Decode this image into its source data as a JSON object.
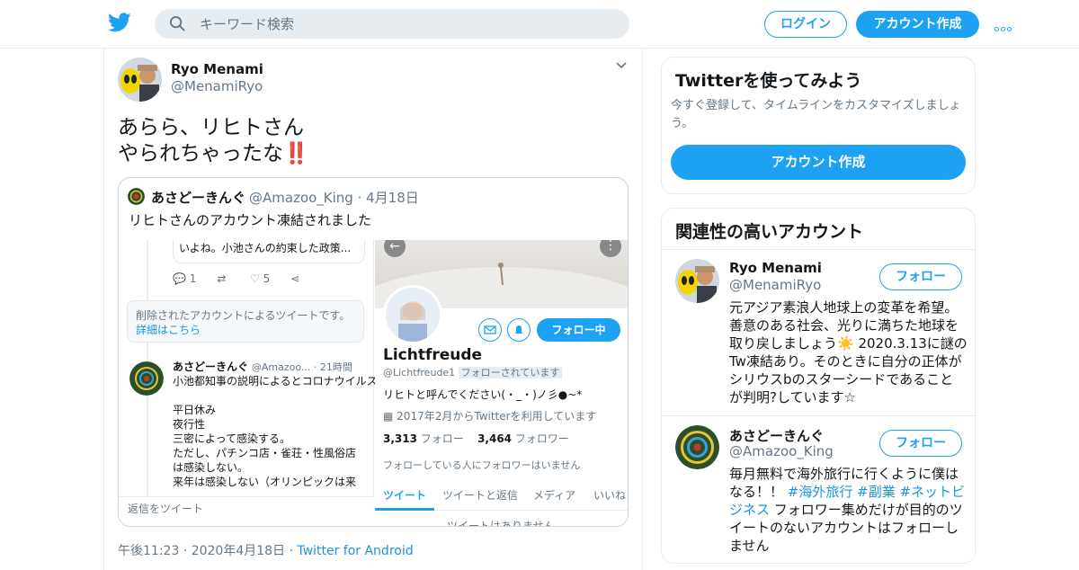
{
  "header": {
    "search_placeholder": "キーワード検索",
    "login_label": "ログイン",
    "signup_label": "アカウント作成"
  },
  "tweet": {
    "author_name": "Ryo Menami",
    "author_handle": "@MenamiRyo",
    "text_line1": "あらら、リヒトさん",
    "text_line2": "やられちゃったな",
    "text_emoji": "‼️",
    "timestamp": "午後11:23 · 2020年4月18日 · ",
    "source": "Twitter for Android"
  },
  "quote": {
    "author_name": "あさどーきんぐ",
    "author_handle": "@Amazoo_King",
    "date": "4月18日",
    "text": "リヒトさんのアカウント凍結されました",
    "screenshot": {
      "left": {
        "snippet": "いよね。小池さんの約束した政策...",
        "reply_count": "1",
        "like_count": "5",
        "deleted_notice": "削除されたアカウントによるツイートです。",
        "details_link": "詳細はこちら",
        "reply_author": "あさどーきんぐ",
        "reply_handle": "@Amazoo... · 21時間",
        "reply_lines": [
          "小池都知事の説明によるとコロナウイルスは",
          "",
          "平日休み",
          "夜行性",
          "三密によって感染する。",
          "ただし、パチンコ店・雀荘・性風俗店",
          "は感染しない。",
          "来年は感染しない（オリンピックは来"
        ],
        "reply_placeholder": "返信をツイート"
      },
      "right": {
        "following_label": "フォロー中",
        "display_name": "Lichtfreude",
        "handle": "@Lichtfreude1",
        "follows_you": "フォローされています",
        "bio": "リヒトと呼んでください(・_・)ノ彡●~*",
        "joined": "2017年2月からTwitterを利用しています",
        "following_count": "3,313",
        "following_label2": "フォロー",
        "followers_count": "3,464",
        "followers_label": "フォロワー",
        "no_mutuals": "フォローしている人にフォロワーはいません",
        "tabs": [
          "ツイート",
          "ツイートと返信",
          "メディア",
          "いいね"
        ],
        "empty_notice": "ツイートはありません"
      }
    }
  },
  "sidebar": {
    "try_card": {
      "title": "Twitterを使ってみよう",
      "desc_line1": "今すぐ登録して、タイムラインをカスタマイズしましょ",
      "desc_line2": "う。",
      "button": "アカウント作成"
    },
    "related": {
      "title": "関連性の高いアカウント",
      "follow_label": "フォロー",
      "accounts": [
        {
          "name": "Ryo Menami",
          "handle": "@MenamiRyo",
          "bio_lines": [
            "元アジア素浪人地球上の変革を希望。",
            "善意のある社会、光りに満ちた地球を",
            "取り戻しましょう☀️ 2020.3.13に謎の",
            "Tw凍結あり。そのときに自分の正体が",
            "シリウスbのスターシードであること",
            "が判明?しています☆"
          ]
        },
        {
          "name": "あさどーきんぐ",
          "handle": "@Amazoo_King",
          "bio_line1": "毎月無料で海外旅行に行くように僕は",
          "bio_line2a": "なる！！ ",
          "hashtag1": "#海外旅行",
          "hashtag2": "#副業",
          "hashtag3": "#ネットビ",
          "hashtag3b": "ジネス",
          "bio_line3rest": " フォロワー集めだけが目的のツ",
          "bio_line4": "イートのないアカウントはフォローし",
          "bio_line5": "ません"
        }
      ]
    }
  }
}
